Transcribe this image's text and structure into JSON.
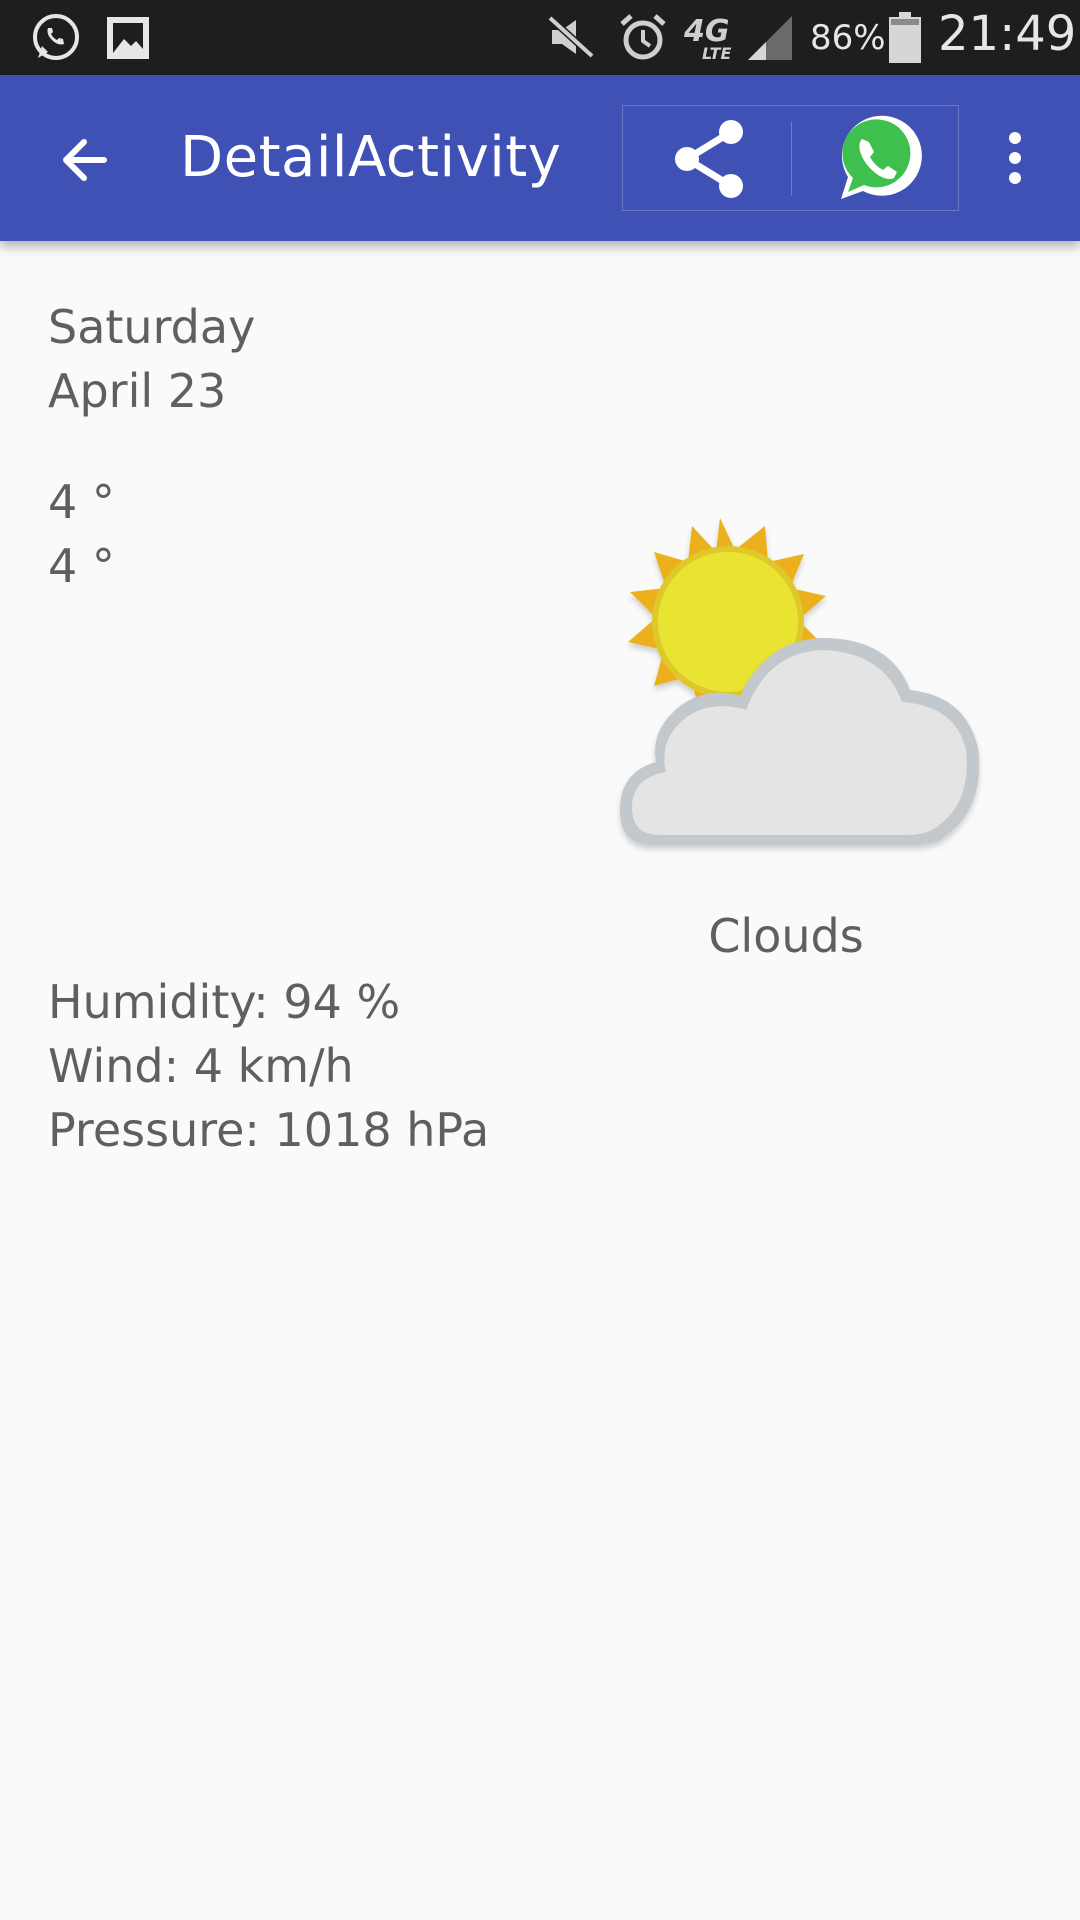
{
  "status_bar": {
    "battery": "86%",
    "time": "21:49",
    "network": "4G",
    "network_sub": "LTE"
  },
  "app_bar": {
    "title": "DetailActivity",
    "color": "#3f51b5"
  },
  "detail": {
    "day": "Saturday",
    "date": "April 23",
    "high": "4 °",
    "low": "4 °",
    "condition": "Clouds",
    "humidity": "Humidity: 94 %",
    "wind": "Wind: 4 km/h",
    "pressure": "Pressure: 1018 hPa",
    "icon": "partly-cloudy-icon"
  }
}
